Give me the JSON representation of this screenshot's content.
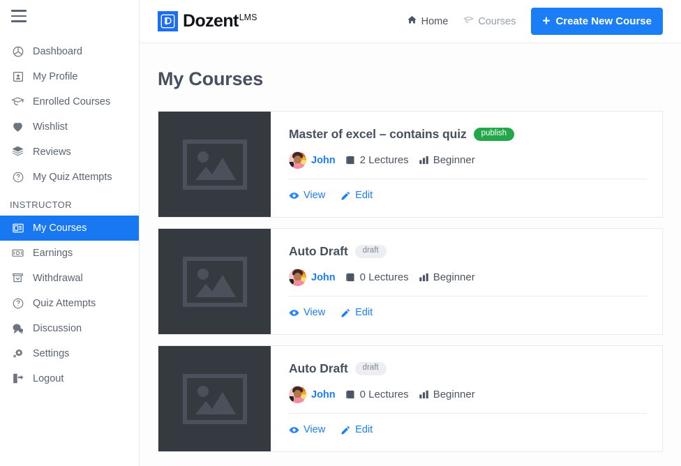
{
  "sidebar": {
    "menu_icon": "hamburger-icon",
    "items": [
      {
        "label": "Dashboard",
        "icon": "dashboard-icon",
        "active": false
      },
      {
        "label": "My Profile",
        "icon": "profile-card-icon",
        "active": false
      },
      {
        "label": "Enrolled Courses",
        "icon": "graduation-cap-icon",
        "active": false
      },
      {
        "label": "Wishlist",
        "icon": "heart-icon",
        "active": false
      },
      {
        "label": "Reviews",
        "icon": "layers-icon",
        "active": false
      },
      {
        "label": "My Quiz Attempts",
        "icon": "question-circle-icon",
        "active": false
      }
    ],
    "section_label": "INSTRUCTOR",
    "instructor_items": [
      {
        "label": "My Courses",
        "icon": "courses-card-icon",
        "active": true
      },
      {
        "label": "Earnings",
        "icon": "money-icon",
        "active": false
      },
      {
        "label": "Withdrawal",
        "icon": "withdraw-icon",
        "active": false
      },
      {
        "label": "Quiz Attempts",
        "icon": "question-circle-icon",
        "active": false
      },
      {
        "label": "Discussion",
        "icon": "chat-bubbles-icon",
        "active": false
      },
      {
        "label": "Settings",
        "icon": "gear-icon",
        "active": false
      },
      {
        "label": "Logout",
        "icon": "logout-icon",
        "active": false
      }
    ]
  },
  "header": {
    "logo_mark_letter": "D",
    "logo_text": "Dozent",
    "logo_superscript": "LMS",
    "nav": [
      {
        "label": "Home",
        "icon": "home-icon"
      },
      {
        "label": "Courses",
        "icon": "graduation-cap-icon"
      }
    ],
    "create_button": {
      "label": "Create New Course",
      "icon": "plus-icon"
    }
  },
  "main": {
    "page_title": "My Courses",
    "courses": [
      {
        "title": "Master of excel – contains quiz",
        "status": "publish",
        "status_type": "publish",
        "author": "John",
        "lectures": "2 Lectures",
        "level": "Beginner",
        "view_label": "View",
        "edit_label": "Edit",
        "thumbnail": "image-placeholder-icon"
      },
      {
        "title": "Auto Draft",
        "status": "draft",
        "status_type": "draft",
        "author": "John",
        "lectures": "0 Lectures",
        "level": "Beginner",
        "view_label": "View",
        "edit_label": "Edit",
        "thumbnail": "image-placeholder-icon"
      },
      {
        "title": "Auto Draft",
        "status": "draft",
        "status_type": "draft",
        "author": "John",
        "lectures": "0 Lectures",
        "level": "Beginner",
        "view_label": "View",
        "edit_label": "Edit",
        "thumbnail": "image-placeholder-icon"
      }
    ]
  },
  "colors": {
    "accent_blue": "#1b7ef7",
    "publish_green": "#22a84a",
    "draft_gray": "#eceef1",
    "thumb_dark": "#343a40",
    "text_slate": "#46505e"
  }
}
